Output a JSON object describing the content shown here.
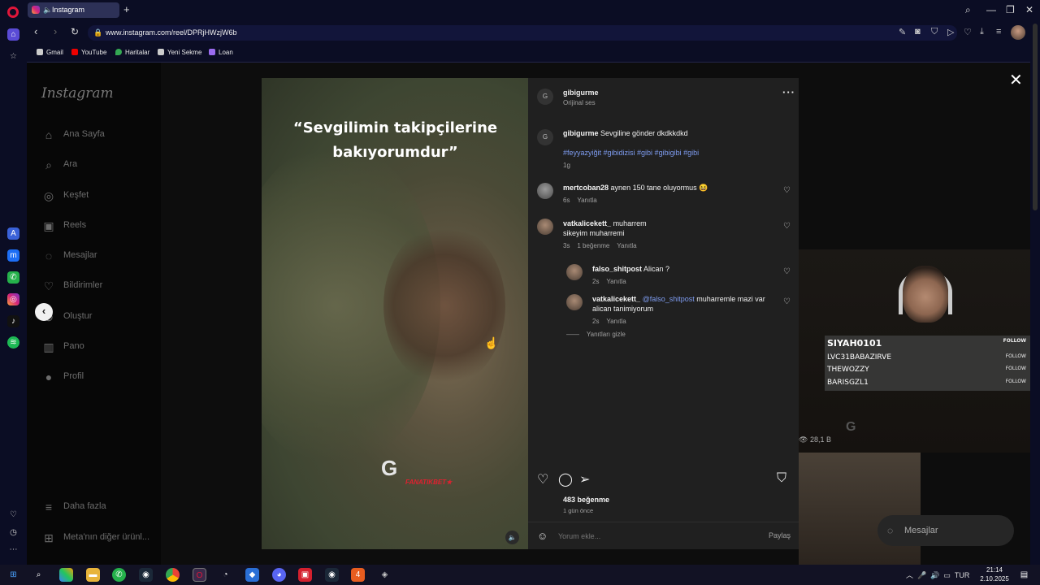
{
  "browser": {
    "tab_title": "Instagram",
    "url": "www.instagram.com/reel/DPRjHWzjW6b",
    "bookmarks": [
      "Gmail",
      "YouTube",
      "Haritalar",
      "Yeni Sekme",
      "Loan"
    ]
  },
  "instagram": {
    "logo": "Instagram",
    "nav": [
      {
        "label": "Ana Sayfa",
        "icon": "home-icon"
      },
      {
        "label": "Ara",
        "icon": "search-icon"
      },
      {
        "label": "Keşfet",
        "icon": "compass-icon"
      },
      {
        "label": "Reels",
        "icon": "reels-icon"
      },
      {
        "label": "Mesajlar",
        "icon": "messenger-icon"
      },
      {
        "label": "Bildirimler",
        "icon": "heart-icon"
      },
      {
        "label": "Oluştur",
        "icon": "plus-icon"
      },
      {
        "label": "Pano",
        "icon": "chart-icon"
      },
      {
        "label": "Profil",
        "icon": "avatar-icon"
      }
    ],
    "more": "Daha fazla",
    "meta_more": "Meta'nın diğer ürünl...",
    "messages_pill": "Mesajlar"
  },
  "reel": {
    "caption_overlay": "“Sevgilimin takipçilerine bakıyorumdur”",
    "watermark_letter": "G",
    "watermark_text": "FANATIKBET★",
    "author": "gibigurme",
    "audio": "Orijinal ses",
    "post": {
      "user": "gibigurme",
      "text": "Sevgiline gönder dkdkkdkd",
      "hashtags": "#feyyazyiğit #gibidizisi #gibi #gibigibi #gibi",
      "time": "1g"
    },
    "comments": [
      {
        "user": "mertcoban28",
        "text": "aynen 150 tane oluyormus 😆",
        "time": "6s",
        "likes": "",
        "reply": "Yanıtla"
      },
      {
        "user": "vatkalicekett_",
        "text": "muharrem",
        "text2": "sikeyim muharremi",
        "time": "3s",
        "likes": "1 beğenme",
        "reply": "Yanıtla"
      }
    ],
    "replies": [
      {
        "user": "falso_shitpost",
        "mention": "",
        "text": "Alican ?",
        "text2": "",
        "time": "2s",
        "reply": "Yanıtla"
      },
      {
        "user": "vatkalicekett_",
        "mention": "@falso_shitpost",
        "text": "muharremle mazi var",
        "text2": "alican tanimiyorum",
        "time": "2s",
        "reply": "Yanıtla"
      }
    ],
    "hide_replies": "Yanıtları gizle",
    "likes": "483 beğenme",
    "posted": "1 gün önce",
    "comment_placeholder": "Yorum ekle...",
    "share": "Paylaş"
  },
  "stream_overlay": {
    "chat": [
      {
        "name": "SIYAH0101",
        "action": "FOLLOW"
      },
      {
        "name": "LVC31BABAZIRVE",
        "action": "FOLLOW"
      },
      {
        "name": "THEWOZZY",
        "action": "FOLLOW"
      },
      {
        "name": "BARISGZL1",
        "action": "FOLLOW"
      }
    ],
    "views": "28,1 B"
  },
  "taskbar": {
    "lang": "TUR",
    "time": "21:14",
    "date": "2.10.2025"
  }
}
